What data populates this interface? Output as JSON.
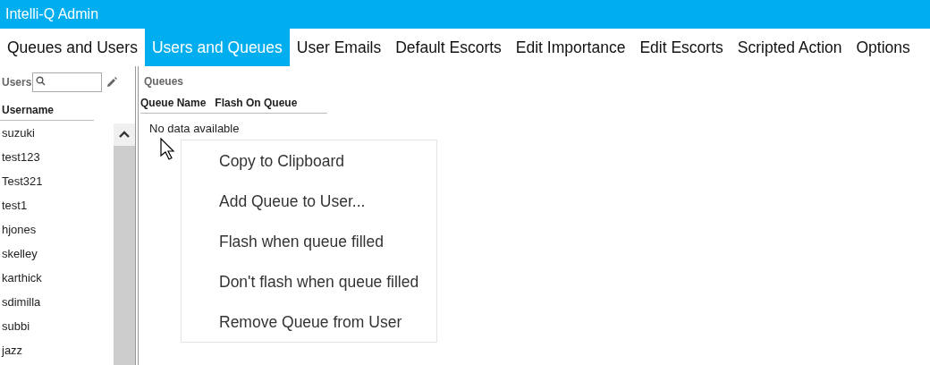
{
  "window": {
    "title": "Intelli-Q Admin"
  },
  "tabs": [
    {
      "label": "Queues and Users",
      "selected": false
    },
    {
      "label": "Users and Queues",
      "selected": true
    },
    {
      "label": "User Emails",
      "selected": false
    },
    {
      "label": "Default Escorts",
      "selected": false
    },
    {
      "label": "Edit Importance",
      "selected": false
    },
    {
      "label": "Edit Escorts",
      "selected": false
    },
    {
      "label": "Scripted Action",
      "selected": false
    },
    {
      "label": "Options",
      "selected": false
    }
  ],
  "users_panel": {
    "title": "Users",
    "column": "Username",
    "rows": [
      "suzuki",
      "test123",
      "Test321",
      "test1",
      "hjones",
      "skelley",
      "karthick",
      "sdimilla",
      "subbi",
      "jazz"
    ]
  },
  "queues_panel": {
    "title": "Queues",
    "columns": [
      "Queue Name",
      "Flash On Queue"
    ],
    "empty_text": "No data available"
  },
  "context_menu": {
    "items": [
      "Copy to Clipboard",
      "Add Queue to User...",
      "Flash when queue filled",
      "Don't flash when queue filled",
      "Remove Queue from User"
    ]
  }
}
